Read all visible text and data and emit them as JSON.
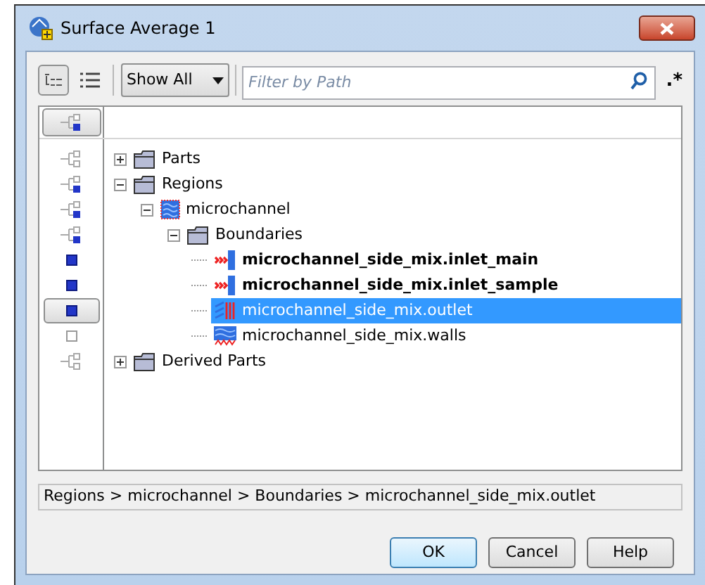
{
  "window": {
    "title": "Surface Average 1"
  },
  "toolbar": {
    "views": [
      {
        "kind": "tree",
        "selected": true
      },
      {
        "kind": "list",
        "selected": false
      }
    ],
    "filter_mode": "Show All",
    "search": {
      "placeholder": "Filter by Path"
    },
    "regex_label": ".*"
  },
  "header_checked": true,
  "tree": [
    {
      "label": "Parts",
      "kind": "folder",
      "checked": false,
      "expanded": false,
      "bold": false,
      "selected": false
    },
    {
      "label": "Regions",
      "kind": "folder",
      "checked": true,
      "expanded": true,
      "bold": false,
      "selected": false,
      "children": [
        {
          "label": "microchannel",
          "kind": "region",
          "checked": true,
          "expanded": true,
          "bold": false,
          "selected": false,
          "children": [
            {
              "label": "Boundaries",
              "kind": "folder",
              "checked": true,
              "expanded": true,
              "bold": false,
              "selected": false,
              "children": [
                {
                  "label": "microchannel_side_mix.inlet_main",
                  "kind": "inlet",
                  "checked": true,
                  "bold": true,
                  "selected": false
                },
                {
                  "label": "microchannel_side_mix.inlet_sample",
                  "kind": "inlet",
                  "checked": true,
                  "bold": true,
                  "selected": false
                },
                {
                  "label": "microchannel_side_mix.outlet",
                  "kind": "outlet",
                  "checked": true,
                  "bold": false,
                  "selected": true
                },
                {
                  "label": "microchannel_side_mix.walls",
                  "kind": "wall",
                  "checked": false,
                  "bold": false,
                  "selected": false
                }
              ]
            }
          ]
        }
      ]
    },
    {
      "label": "Derived Parts",
      "kind": "folder",
      "checked": false,
      "expanded": false,
      "bold": false,
      "selected": false
    }
  ],
  "path": "Regions > microchannel > Boundaries > microchannel_side_mix.outlet",
  "buttons": [
    {
      "label": "OK",
      "default": true
    },
    {
      "label": "Cancel",
      "default": false
    },
    {
      "label": "Help",
      "default": false
    }
  ]
}
